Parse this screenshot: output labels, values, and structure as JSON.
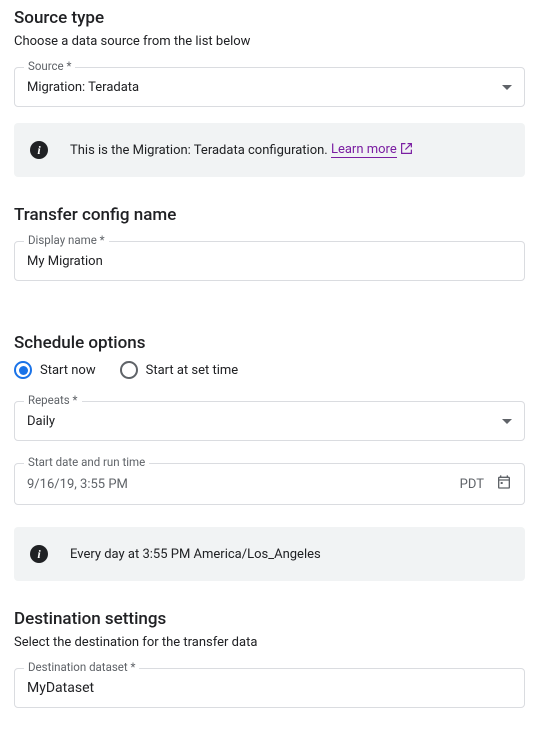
{
  "sourceType": {
    "title": "Source type",
    "subtitle": "Choose a data source from the list below",
    "field": {
      "label": "Source *",
      "value": "Migration: Teradata"
    },
    "info": {
      "text": "This is the Migration: Teradata configuration. ",
      "link": "Learn more"
    }
  },
  "transferConfig": {
    "title": "Transfer config name",
    "field": {
      "label": "Display name *",
      "value": "My Migration"
    }
  },
  "schedule": {
    "title": "Schedule options",
    "radios": {
      "startNow": "Start now",
      "startAtSetTime": "Start at set time"
    },
    "repeats": {
      "label": "Repeats *",
      "value": "Daily"
    },
    "startDate": {
      "label": "Start date and run time",
      "value": "9/16/19, 3:55 PM",
      "tz": "PDT"
    },
    "info": "Every day at 3:55 PM America/Los_Angeles"
  },
  "destination": {
    "title": "Destination settings",
    "subtitle": "Select the destination for the transfer data",
    "field": {
      "label": "Destination dataset *",
      "value": "MyDataset"
    }
  }
}
